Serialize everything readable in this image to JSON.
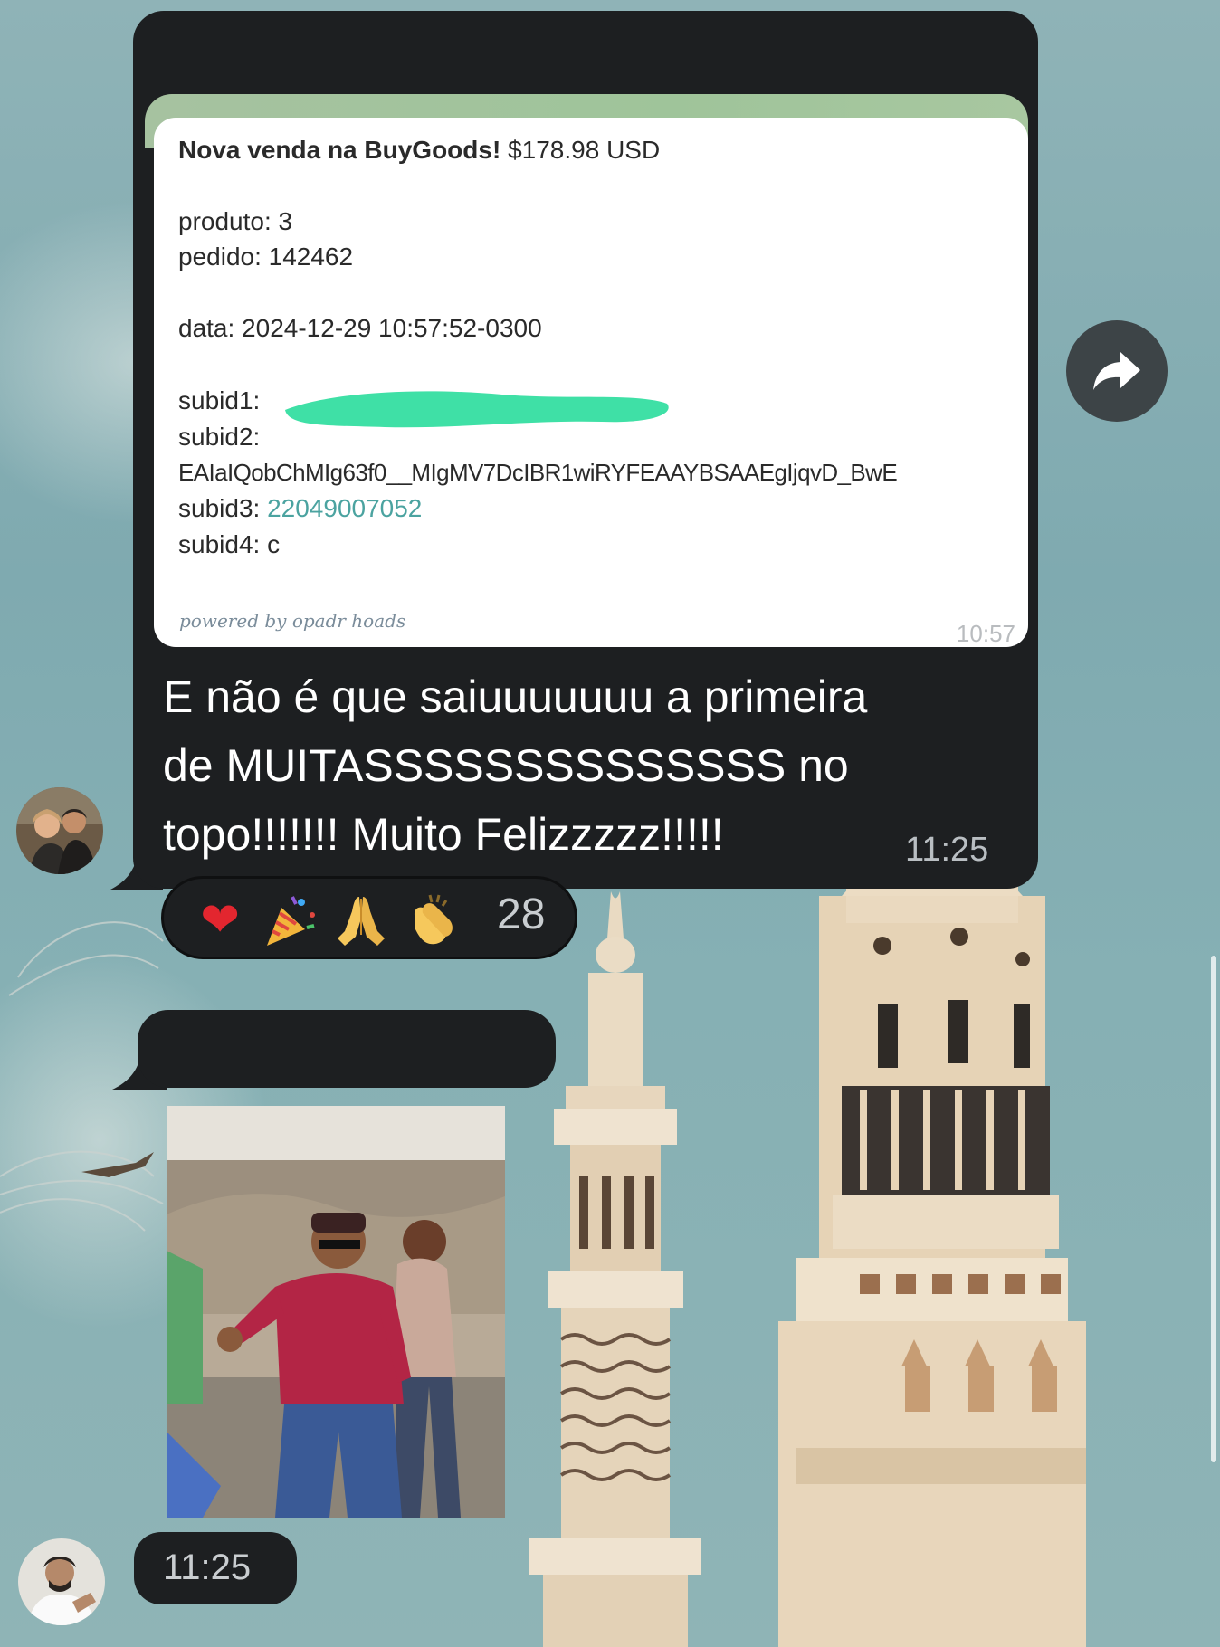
{
  "message": {
    "bot_card": {
      "title_bold": "Nova venda na BuyGoods!",
      "title_amount": "$178.98 USD",
      "produto": "produto: 3",
      "pedido": "pedido: 142462",
      "data": "data: 2024-12-29 10:57:52-0300",
      "subid1_label": "subid1:",
      "subid2_label": "subid2:",
      "subid2_value": "EAIaIQobChMIg63f0__MIgMV7DcIBR1wiRYFEAAYBSAAEgIjqvD_BwE",
      "subid3_label": "subid3:",
      "subid3_value": "22049007052",
      "subid4": "subid4: c",
      "powered_by": "powered by opadr hoads",
      "time": "10:57"
    },
    "caption_lines": [
      "E não é que saiuuuuuuu a primeira",
      "de MUITASSSSSSSSSSSSSS no",
      "topo!!!!!!! Muito Felizzzzz!!!!!"
    ],
    "time": "11:25",
    "reactions": {
      "emojis": [
        "red-heart",
        "party-popper",
        "folded-hands",
        "clapping-hands"
      ],
      "count": "28"
    }
  },
  "message2": {
    "time": "11:25"
  },
  "colors": {
    "bubble": "#1d1f21",
    "bot_header": "#a6c2a0",
    "link": "#4ba3a0",
    "highlight_redaction": "#3fe0a6",
    "background_sky": "#86b0b4"
  }
}
